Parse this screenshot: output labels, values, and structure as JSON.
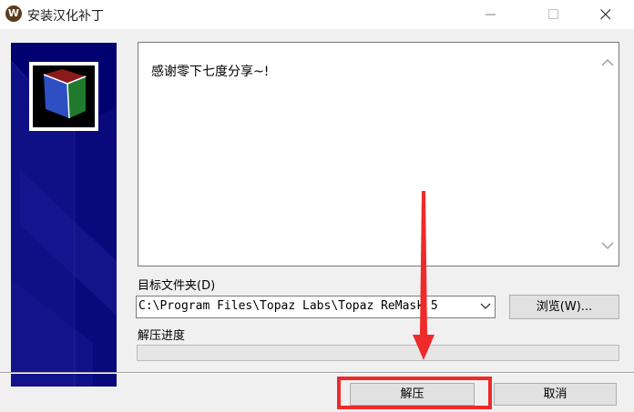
{
  "window": {
    "title": "安装汉化补丁",
    "app_icon_letter": "W"
  },
  "message": {
    "text": "感谢零下七度分享~!"
  },
  "destination": {
    "label": "目标文件夹(D)",
    "path": "C:\\Program Files\\Topaz Labs\\Topaz ReMask 5",
    "browse_label": "浏览(W)..."
  },
  "progress": {
    "label": "解压进度",
    "percent": 0
  },
  "buttons": {
    "extract_label": "解压",
    "cancel_label": "取消"
  },
  "colors": {
    "banner_blue": "#000071",
    "highlight_red": "#ee2a2a",
    "logo_red": "#8b1a1a",
    "logo_green": "#1f7a2e",
    "logo_blue": "#2e4fc4"
  },
  "icons": {
    "minimize": "minimize-icon",
    "maximize": "maximize-icon",
    "close": "close-icon",
    "scroll_up": "chevron-up-icon",
    "scroll_down": "chevron-down-icon",
    "dropdown": "chevron-down-icon",
    "annotation_arrow": "arrow-down-icon"
  }
}
